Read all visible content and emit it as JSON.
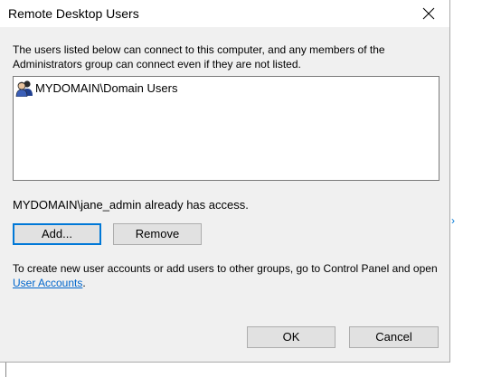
{
  "window": {
    "title": "Remote Desktop Users"
  },
  "description": "The users listed below can connect to this computer, and any members of the Administrators group can connect even if they are not listed.",
  "users_list": [
    {
      "label": "MYDOMAIN\\Domain Users",
      "icon": "user-group-icon"
    }
  ],
  "access_status": "MYDOMAIN\\jane_admin already has access.",
  "buttons": {
    "add": "Add...",
    "remove": "Remove",
    "ok": "OK",
    "cancel": "Cancel"
  },
  "info": {
    "prefix": "To create new user accounts or add users to other groups, go to Control Panel and open ",
    "link": "User Accounts",
    "suffix": "."
  },
  "background": {
    "chevron": "›"
  },
  "colors": {
    "accent": "#0078d7",
    "link": "#0066cc",
    "dialog_bg": "#f0f0f0"
  }
}
